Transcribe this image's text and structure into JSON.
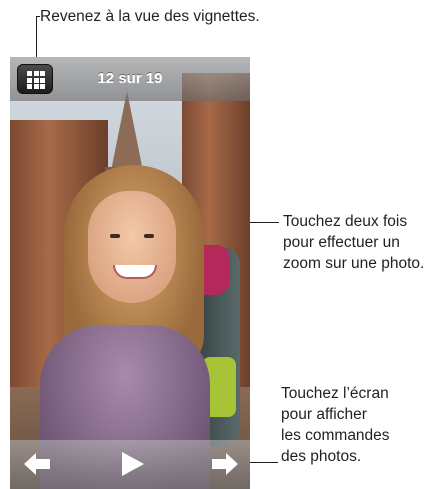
{
  "callouts": {
    "thumbnails": "Revenez à la vue des vignettes.",
    "zoom": [
      "Touchez deux fois",
      "pour effectuer un",
      "zoom sur une photo."
    ],
    "controls": [
      "Touchez l’écran",
      "pour afficher",
      "les commandes",
      "des photos."
    ]
  },
  "toolbar": {
    "counter": "12 sur 19",
    "thumbnails_icon": "grid-icon"
  },
  "playback": {
    "previous_icon": "arrow-left-icon",
    "play_icon": "play-icon",
    "next_icon": "arrow-right-icon"
  },
  "colors": {
    "callout_text": "#231f20",
    "bar_overlay": "#8a8a8a",
    "icon_color": "#ffffff"
  }
}
